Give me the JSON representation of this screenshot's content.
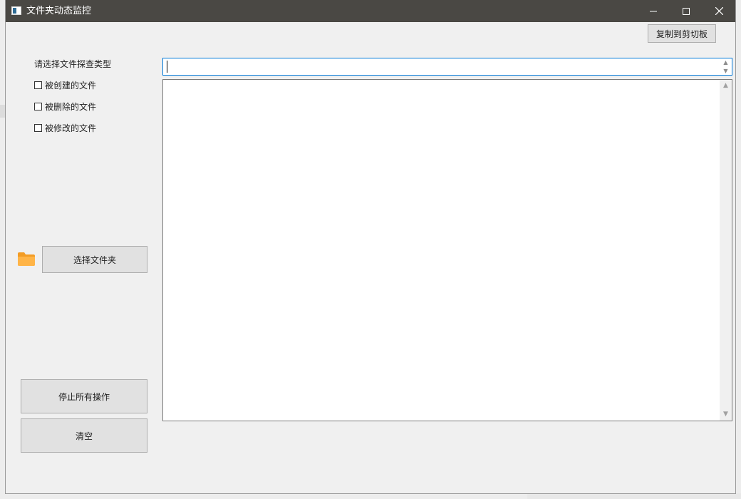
{
  "window": {
    "title": "文件夹动态监控",
    "controls": {
      "minimize": "minimize",
      "maximize": "maximize",
      "close": "close"
    }
  },
  "toolbar": {
    "copy_to_clipboard_label": "复制到剪切板"
  },
  "sidebar": {
    "probe_type_title": "请选择文件探查类型",
    "options": [
      {
        "label": "被创建的文件",
        "checked": false
      },
      {
        "label": "被删除的文件",
        "checked": false
      },
      {
        "label": "被修改的文件",
        "checked": false
      }
    ],
    "choose_folder_label": "选择文件夹",
    "stop_all_label": "停止所有操作",
    "clear_label": "清空",
    "folder_icon": "folder-icon"
  },
  "main": {
    "path_input_value": "",
    "log_text": ""
  },
  "colors": {
    "titlebar": "#4a4844",
    "window_bg": "#f0f0f0",
    "button_bg": "#e1e1e1",
    "focus_border": "#0078d7",
    "folder_orange": "#f7a536"
  }
}
